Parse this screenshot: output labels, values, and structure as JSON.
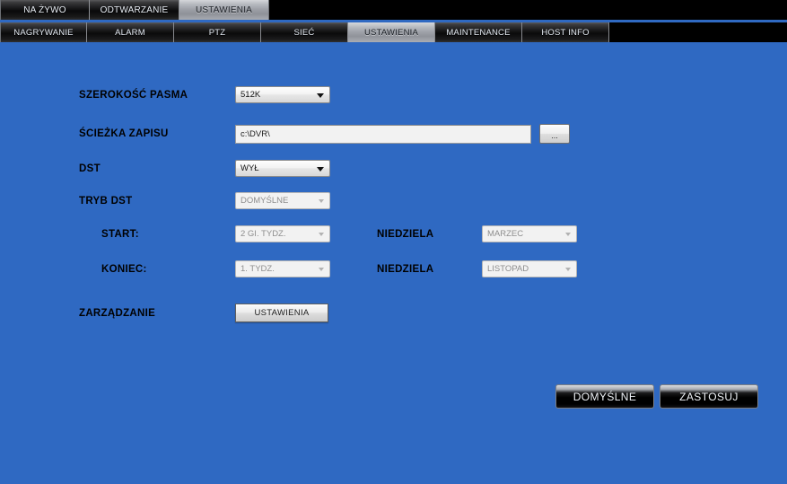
{
  "top_tabs": [
    {
      "label": "NA ŻYWO",
      "active": false
    },
    {
      "label": "ODTWARZANIE",
      "active": false
    },
    {
      "label": "USTAWIENIA",
      "active": true
    }
  ],
  "sub_tabs": [
    {
      "label": "NAGRYWANIE",
      "active": false
    },
    {
      "label": "ALARM",
      "active": false
    },
    {
      "label": "PTZ",
      "active": false
    },
    {
      "label": "SIEĆ",
      "active": false
    },
    {
      "label": "USTAWIENIA",
      "active": true
    },
    {
      "label": "MAINTENANCE",
      "active": false
    },
    {
      "label": "HOST INFO",
      "active": false
    }
  ],
  "form": {
    "bandwidth": {
      "label": "SZEROKOŚĆ PASMA",
      "value": "512K"
    },
    "record_path": {
      "label": "ŚCIEŻKA ZAPISU",
      "value": "c:\\DVR\\",
      "browse_label": "..."
    },
    "dst": {
      "label": "DST",
      "value": "WYŁ"
    },
    "dst_mode": {
      "label": "TRYB DST",
      "value": "DOMYŚLNE"
    },
    "start": {
      "label": "START:",
      "week_value": "2 GI. TYDZ.",
      "day_label": "NIEDZIELA",
      "month_value": "MARZEC"
    },
    "end": {
      "label": "KONIEC:",
      "week_value": "1. TYDZ.",
      "day_label": "NIEDZIELA",
      "month_value": "LISTOPAD"
    },
    "management": {
      "label": "ZARZĄDZANIE",
      "button_label": "USTAWIENIA"
    }
  },
  "actions": {
    "default_label": "DOMYŚLNE",
    "apply_label": "ZASTOSUJ"
  },
  "colors": {
    "background_blue": "#2f69c2",
    "tab_bar_black": "#000000",
    "active_tab_grey": "#a9acb2",
    "label_text": "#000000"
  }
}
